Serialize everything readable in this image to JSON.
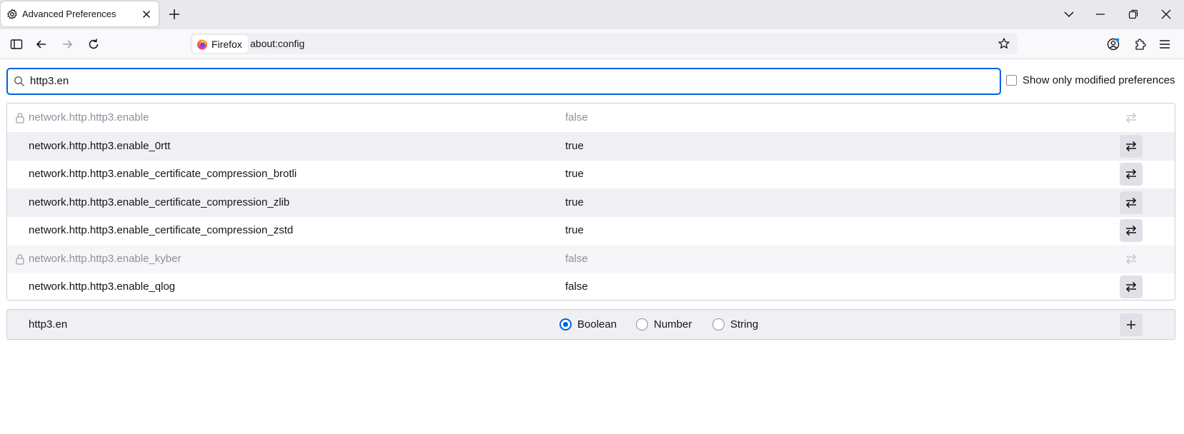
{
  "window": {
    "tab_title": "Advanced Preferences"
  },
  "navbar": {
    "identity_label": "Firefox",
    "url": "about:config"
  },
  "search": {
    "value": "http3.en",
    "modified_label": "Show only modified preferences",
    "modified_checked": false
  },
  "prefs": [
    {
      "name": "network.http.http3.enable",
      "value": "false",
      "locked": true
    },
    {
      "name": "network.http.http3.enable_0rtt",
      "value": "true",
      "locked": false
    },
    {
      "name": "network.http.http3.enable_certificate_compression_brotli",
      "value": "true",
      "locked": false
    },
    {
      "name": "network.http.http3.enable_certificate_compression_zlib",
      "value": "true",
      "locked": false
    },
    {
      "name": "network.http.http3.enable_certificate_compression_zstd",
      "value": "true",
      "locked": false
    },
    {
      "name": "network.http.http3.enable_kyber",
      "value": "false",
      "locked": true
    },
    {
      "name": "network.http.http3.enable_qlog",
      "value": "false",
      "locked": false
    }
  ],
  "new_pref": {
    "name": "http3.en",
    "types": [
      "Boolean",
      "Number",
      "String"
    ],
    "selected_type": "Boolean"
  },
  "colors": {
    "accent": "#0061e0",
    "locked_text": "#8f8f9d"
  }
}
